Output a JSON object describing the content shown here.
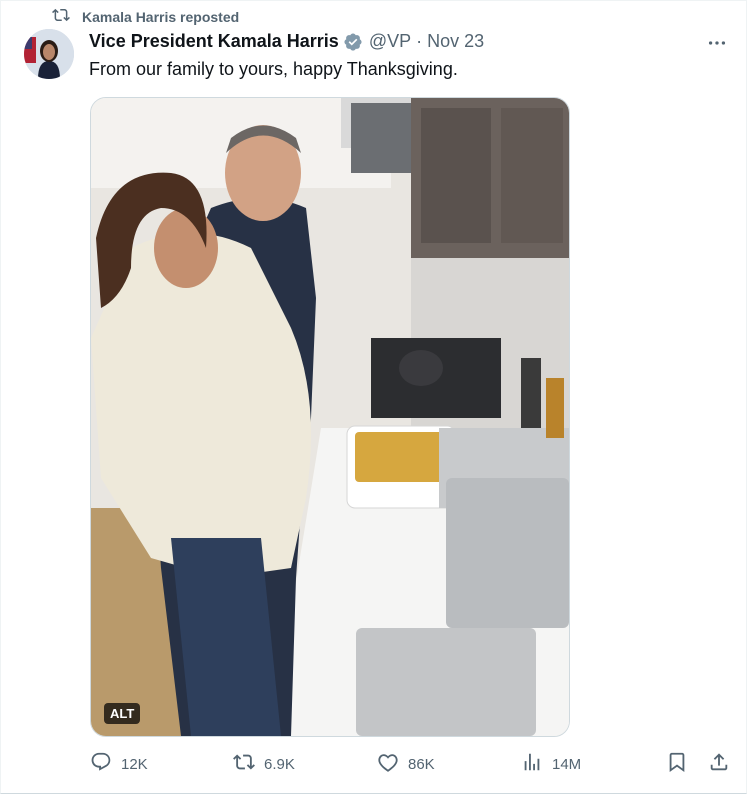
{
  "repost": {
    "label": "Kamala Harris reposted",
    "icon": "repost-icon"
  },
  "tweet": {
    "display_name": "Vice President Kamala Harris",
    "verified_icon": "verified-badge-icon",
    "handle": "@VP",
    "separator": "·",
    "date": "Nov 23",
    "text": "From our family to yours, happy Thanksgiving.",
    "media": {
      "alt_badge": "ALT"
    }
  },
  "actions": {
    "replies": "12K",
    "reposts": "6.9K",
    "likes": "86K",
    "views": "14M"
  },
  "colors": {
    "text": "#0f1419",
    "secondary": "#536471",
    "verified": "#829aab",
    "border": "#eff3f4"
  }
}
